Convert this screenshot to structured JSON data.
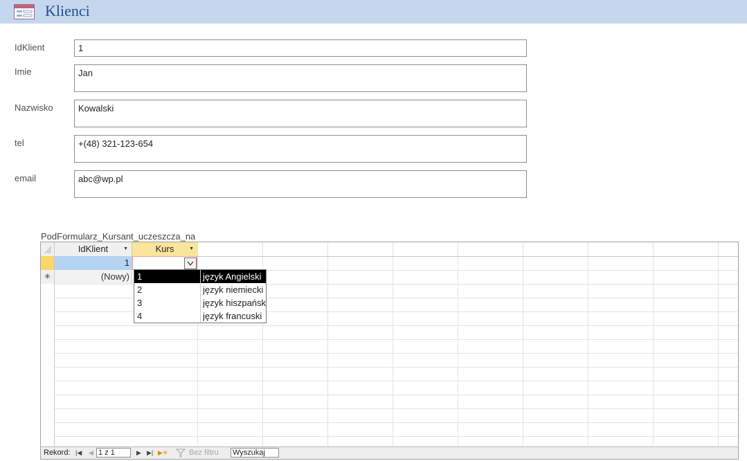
{
  "form": {
    "title": "Klienci",
    "icon": "form-icon",
    "fields": [
      {
        "label": "IdKlient",
        "value": "1"
      },
      {
        "label": "Imie",
        "value": "Jan"
      },
      {
        "label": "Nazwisko",
        "value": "Kowalski"
      },
      {
        "label": "tel",
        "value": "+(48) 321-123-654"
      },
      {
        "label": "email",
        "value": "abc@wp.pl"
      }
    ]
  },
  "subform": {
    "label": "PodFormularz_Kursant_uczeszcza_na",
    "columns": [
      "IdKlient",
      "Kurs"
    ],
    "rows": [
      {
        "IdKlient": "1",
        "Kurs": ""
      }
    ],
    "new_row_label": "(Nowy)",
    "new_row_marker": "✳",
    "dropdown": [
      {
        "id": "1",
        "name": "język Angielski",
        "selected": true
      },
      {
        "id": "2",
        "name": "język niemiecki"
      },
      {
        "id": "3",
        "name": "język hiszpański"
      },
      {
        "id": "4",
        "name": "język francuski"
      }
    ],
    "navigation": {
      "record_label": "Rekord:",
      "position": "1 z 1",
      "filter_label": "Bez filtru",
      "search_label": "Wyszukaj"
    }
  },
  "colors": {
    "header_bg": "#c5d7ee",
    "title": "#1f4e8f",
    "active_col_header": "#fbe49b",
    "current_cell": "#b5d3f2",
    "selected_row_marker": "#fbd567",
    "dropdown_selected": "#000000"
  }
}
